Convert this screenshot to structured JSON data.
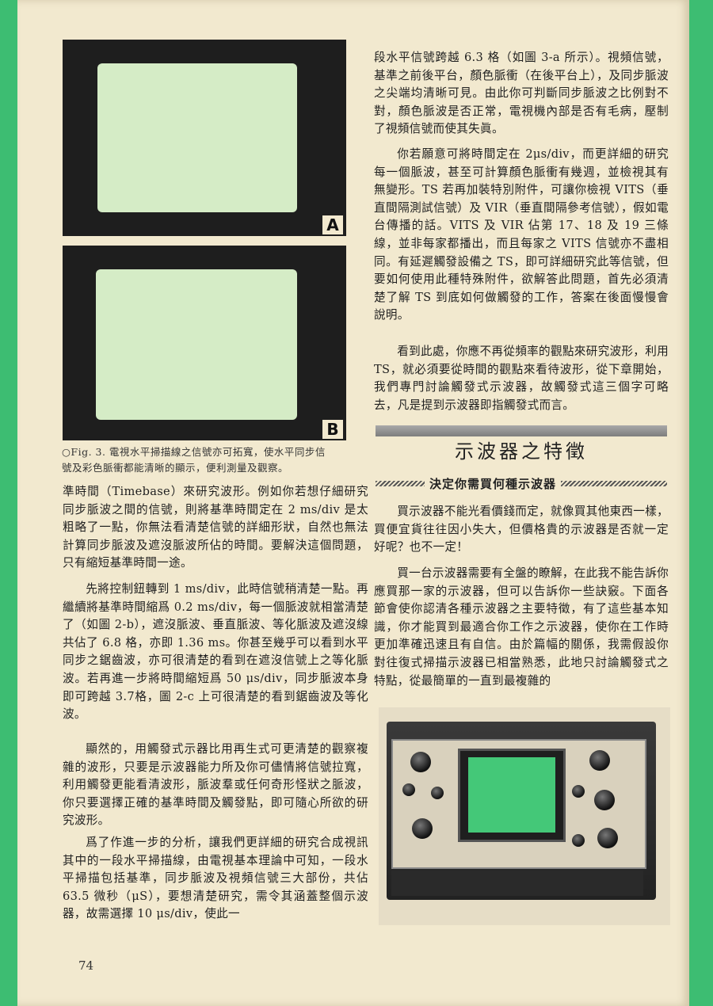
{
  "figure": {
    "panel_a_label": "A",
    "panel_b_label": "B",
    "caption_line1": "○Fig. 3. 電視水平掃描線之信號亦可拓寬，使水平同步信",
    "caption_line2": "號及彩色脈衝都能清晰的顯示，便利測量及觀察。"
  },
  "left_column": {
    "p1": "準時間（Timebase）來研究波形。例如你若想仔細研究同步脈波之間的信號，則將基準時間定在 2 ms/div 是太粗略了一點，你無法看清楚信號的詳細形狀，自然也無法計算同步脈波及遮沒脈波所佔的時間。要解決這個問題，只有縮短基準時間一途。",
    "p2": "先將控制鈕轉到 1 ms/div，此時信號稍清楚一點。再繼續將基準時間縮爲 0.2 ms/div，每一個脈波就相當清楚了（如圖 2-b），遮沒脈波、垂直脈波、等化脈波及遮沒線共佔了 6.8 格，亦即 1.36 ms。你甚至幾乎可以看到水平同步之鋸齒波，亦可很清楚的看到在遮沒信號上之等化脈波。若再進一步將時間縮短爲 50 μs/div，同步脈波本身即可跨越 3.7格，圖 2-c 上可很清楚的看到鋸齒波及等化波。",
    "p3": "顯然的，用觸發式示器比用再生式可更清楚的觀察複雜的波形，只要是示波器能力所及你可儘情將信號拉寬，利用觸發更能看清波形，脈波羣或任何奇形怪狀之脈波，你只要選擇正確的基準時間及觸發點，即可隨心所欲的研究波形。",
    "p4": "爲了作進一步的分析，讓我們更詳細的研究合成視訊其中的一段水平掃描線，由電視基本理論中可知，一段水平掃描包括基準，同步脈波及視頻信號三大部份，共佔 63.5 微秒（μS），要想清楚研究，需令其涵蓋整個示波器，故需選擇 10 μs/div，使此一"
  },
  "right_column": {
    "p1": "段水平信號跨越 6.3 格（如圖 3-a 所示）。視頻信號，基準之前後平台，顏色脈衝（在後平台上），及同步脈波之尖端均清晰可見。由此你可判斷同步脈波之比例對不對，顏色脈波是否正常，電視機內部是否有毛病，壓制了視頻信號而使其失眞。",
    "p2": "你若願意可將時間定在 2μs/div，而更詳細的研究每一個脈波，甚至可計算顏色脈衝有幾週，並檢視其有無變形。TS 若再加裝特別附件，可讓你檢視 VITS（垂直間隔測試信號）及 VIR（垂直間隔參考信號），假如電台傳播的話。VITS 及 VIR 佔第 17、18 及 19 三條線，並非每家都播出，而且每家之 VITS 信號亦不盡相同。有延遲觸發設備之 TS，即可詳細研究此等信號，但要如何使用此種特殊附件，欲解答此問題，首先必須清楚了解 TS 到底如何做觸發的工作，答案在後面慢慢會說明。",
    "p3": "看到此處，你應不再從頻率的觀點來研究波形，利用 TS，就必須要從時間的觀點來看待波形，從下章開始，我們專門討論觸發式示波器，故觸發式這三個字可略去，凡是提到示波器即指觸發式而言。",
    "section_title": "示波器之特徵",
    "sub_heading": "決定你需買何種示波器",
    "p4": "買示波器不能光看價錢而定，就像買其他東西一樣，買便宜貨往往因小失大，但價格貴的示波器是否就一定好呢？也不一定！",
    "p5": "買一台示波器需要有全盤的瞭解，在此我不能告訴你應買那一家的示波器，但可以告訴你一些訣竅。下面各節會使你認清各種示波器之主要特徵，有了這些基本知識，你才能買到最適合你工作之示波器，使你在工作時更加準確迅速且有自信。由於篇幅的關係，我需假設你對往復式掃描示波器已相當熟悉，此地只討論觸發式之特點，從最簡單的一直到最複雜的"
  },
  "page_number": "74",
  "colors": {
    "margin_green": "#3dbd72",
    "paper": "#f2e9cf",
    "scope_screen": "#44c878"
  }
}
